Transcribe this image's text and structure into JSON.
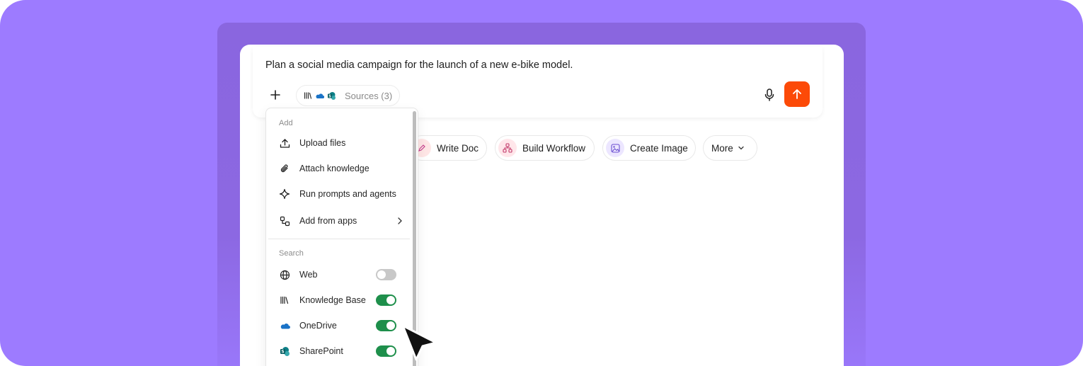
{
  "composer": {
    "prompt": "Plan a social media campaign for the launch of a new e-bike model.",
    "sources_label": "Sources (3)"
  },
  "chips": [
    {
      "label": "Write Doc",
      "icon": "pen-icon"
    },
    {
      "label": "Build Workflow",
      "icon": "workflow-icon"
    },
    {
      "label": "Create Image",
      "icon": "image-icon"
    },
    {
      "label": "More",
      "icon": "chevron-down-icon"
    }
  ],
  "menu": {
    "add_section": "Add",
    "add_items": [
      {
        "label": "Upload files",
        "icon": "upload-icon"
      },
      {
        "label": "Attach knowledge",
        "icon": "paperclip-icon"
      },
      {
        "label": "Run prompts and agents",
        "icon": "sparkle-icon"
      },
      {
        "label": "Add from apps",
        "icon": "apps-icon"
      }
    ],
    "search_section": "Search",
    "search_items": [
      {
        "label": "Web",
        "icon": "globe-icon",
        "enabled": false
      },
      {
        "label": "Knowledge Base",
        "icon": "library-icon",
        "enabled": true
      },
      {
        "label": "OneDrive",
        "icon": "onedrive-icon",
        "enabled": true
      },
      {
        "label": "SharePoint",
        "icon": "sharepoint-icon",
        "enabled": true
      }
    ]
  },
  "colors": {
    "background": "#9d7bff",
    "send_button": "#fc4a08",
    "toggle_on": "#1e8f4b",
    "toggle_off": "#c8c8c8"
  }
}
